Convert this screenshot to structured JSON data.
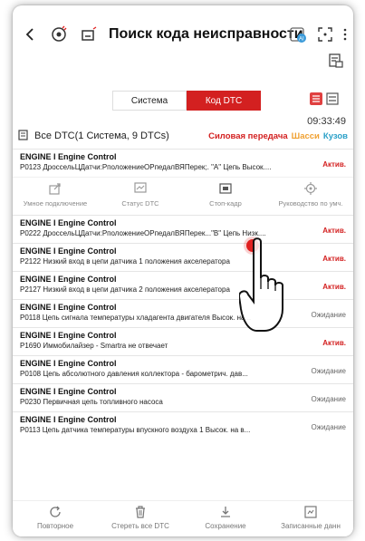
{
  "header": {
    "title": "Поиск кода неисправности",
    "icons": [
      "back-icon",
      "vci-icon",
      "car-icon",
      "ai-icon",
      "scan-frame-icon",
      "more-icon"
    ]
  },
  "tabs": [
    {
      "label": "Система",
      "active": false
    },
    {
      "label": "Код DTC",
      "active": true
    }
  ],
  "summary": {
    "label": "Все DTC(1 Система, 9 DTCs)",
    "time": "09:33:49",
    "categories": [
      {
        "label": "Силовая передача",
        "color": "#d32020"
      },
      {
        "label": "Шасси",
        "color": "#f0a030"
      },
      {
        "label": "Кузов",
        "color": "#2aa0c8"
      }
    ]
  },
  "dtcs": [
    {
      "module": "ENGINE I Engine Control",
      "desc": "P0123 ДроссельЦДатчи:РположениеОРпедалВЯПерек;. \"А\" Цепь Высок....",
      "status": "Актив."
    },
    {
      "module": "ENGINE I Engine Control",
      "desc": "P0222 ДроссельЦДатчи:РположениеОРпедалВЯПерек...\"В\" Цепь Низк....",
      "status": "Актив."
    },
    {
      "module": "ENGINE I Engine Control",
      "desc": "P2122 Низкий вход в цепи датчика 1 положения акселератора",
      "status": "Актив."
    },
    {
      "module": "ENGINE I Engine Control",
      "desc": "P2127 Низкий вход в цепи датчика 2 положения акселератора",
      "status": "Актив."
    },
    {
      "module": "ENGINE I Engine Control",
      "desc": "P0118 Цепь сигнала температуры хладагента двигателя Высок. на...",
      "status": "Ожидание"
    },
    {
      "module": "ENGINE I Engine Control",
      "desc": "P1690 Иммобилайзер - Smartra не отвечает",
      "status": "Актив."
    },
    {
      "module": "ENGINE I Engine Control",
      "desc": "P0108 Цепь абсолютного давления коллектора - барометрич. дав...",
      "status": "Ожидание"
    },
    {
      "module": "ENGINE I Engine Control",
      "desc": "P0230 Первичная цепь топливного насоса",
      "status": "Ожидание"
    },
    {
      "module": "ENGINE I Engine Control",
      "desc": "P0113 Цепь датчика температуры впускного воздуха 1 Высок. на в...",
      "status": "Ожидание"
    }
  ],
  "row_actions": [
    {
      "label": "Умное подключение",
      "icon": "share-icon"
    },
    {
      "label": "Статус DTC",
      "icon": "dtc-status-icon"
    },
    {
      "label": "Стоп-кадр",
      "icon": "freeze-frame-icon"
    },
    {
      "label": "Руководство по умч.",
      "icon": "gear-icon"
    }
  ],
  "bottom_bar": [
    {
      "label": "Повторное",
      "icon": "refresh-icon"
    },
    {
      "label": "Стереть все DTC",
      "icon": "trash-icon"
    },
    {
      "label": "Сохранение",
      "icon": "download-icon"
    },
    {
      "label": "Записанные данн",
      "icon": "record-icon"
    }
  ],
  "colors": {
    "accent": "#d32020",
    "active_status": "#d32020",
    "wait_status": "#666666"
  }
}
